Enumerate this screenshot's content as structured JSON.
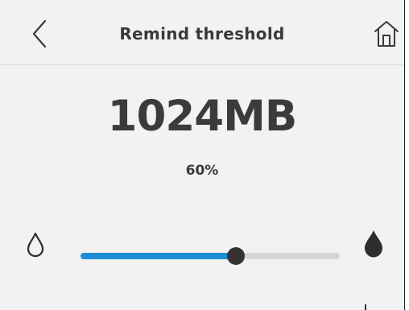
{
  "header": {
    "title": "Remind threshold",
    "back_icon": "chevron-left-icon",
    "home_icon": "home-icon"
  },
  "threshold": {
    "value_text": "1024MB",
    "percent_text": "60%",
    "slider_level": 0.6
  },
  "icons": {
    "low": "water-drop-outline-icon",
    "high": "water-drop-filled-icon"
  },
  "colors": {
    "background": "#f2f2f2",
    "accent": "#1e8fd6",
    "track": "#d6d6d6",
    "thumb": "#333333",
    "text": "#3b3b3b"
  }
}
